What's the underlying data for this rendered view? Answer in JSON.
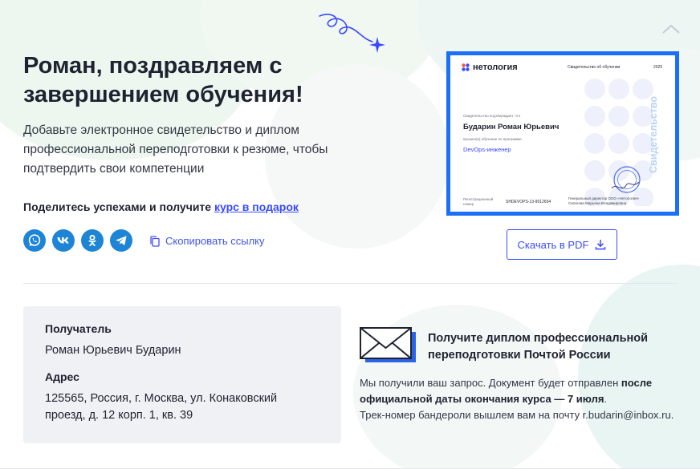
{
  "heading": "Роман, поздравляем с завершением обучения!",
  "subtitle": "Добавьте электронное свидетельство и диплом профессиональной переподготовки к резюме, чтобы подтвердить свои компетенции",
  "share": {
    "text": "Поделитесь успехами и получите",
    "link": "курс в подарок",
    "networks": [
      {
        "name": "whatsapp",
        "icon": "whatsapp-icon"
      },
      {
        "name": "vk",
        "icon": "vk-icon"
      },
      {
        "name": "odnoklassniki",
        "icon": "odnoklassniki-icon"
      },
      {
        "name": "telegram",
        "icon": "telegram-icon"
      }
    ],
    "copy_label": "Скопировать ссылку"
  },
  "certificate": {
    "logo": "нетология",
    "doc_type": "Свидетельство об обучении",
    "year": "2025",
    "confirm_text": "Свидетельство подтверждает, что",
    "name": "Бударин Роман Юрьевич",
    "program_label": "прошел(а) обучение по программе",
    "program": "DevOps-инженер",
    "reg_label": "Регистрационный номер",
    "reg_number": "SHDEVOPS-13-9012654",
    "director": "Генеральный директор ООО «Нетология» Сигалова Марьяна Владимировна",
    "vertical_text": "Свидетельство"
  },
  "download_button": "Скачать в PDF",
  "recipient": {
    "label": "Получатель",
    "name": "Роман Юрьевич Бударин",
    "address_label": "Адрес",
    "address": "125565, Россия, г. Москва, ул. Конаковский проезд, д. 12 корп. 1, кв. 39"
  },
  "mail": {
    "title": "Получите диплом профессиональной переподготовки Почтой России",
    "text_1": "Мы получили ваш запрос. Документ будет отправлен",
    "text_bold": "после официальной даты окончания курса — 7 июля",
    "text_2": ".",
    "text_3": "Трек-номер бандероли вышлем вам на почту r.budarin@inbox.ru."
  },
  "colors": {
    "accent": "#3a4aff",
    "social": "#1e84d6",
    "certificate_frame": "#1c6ff7"
  }
}
